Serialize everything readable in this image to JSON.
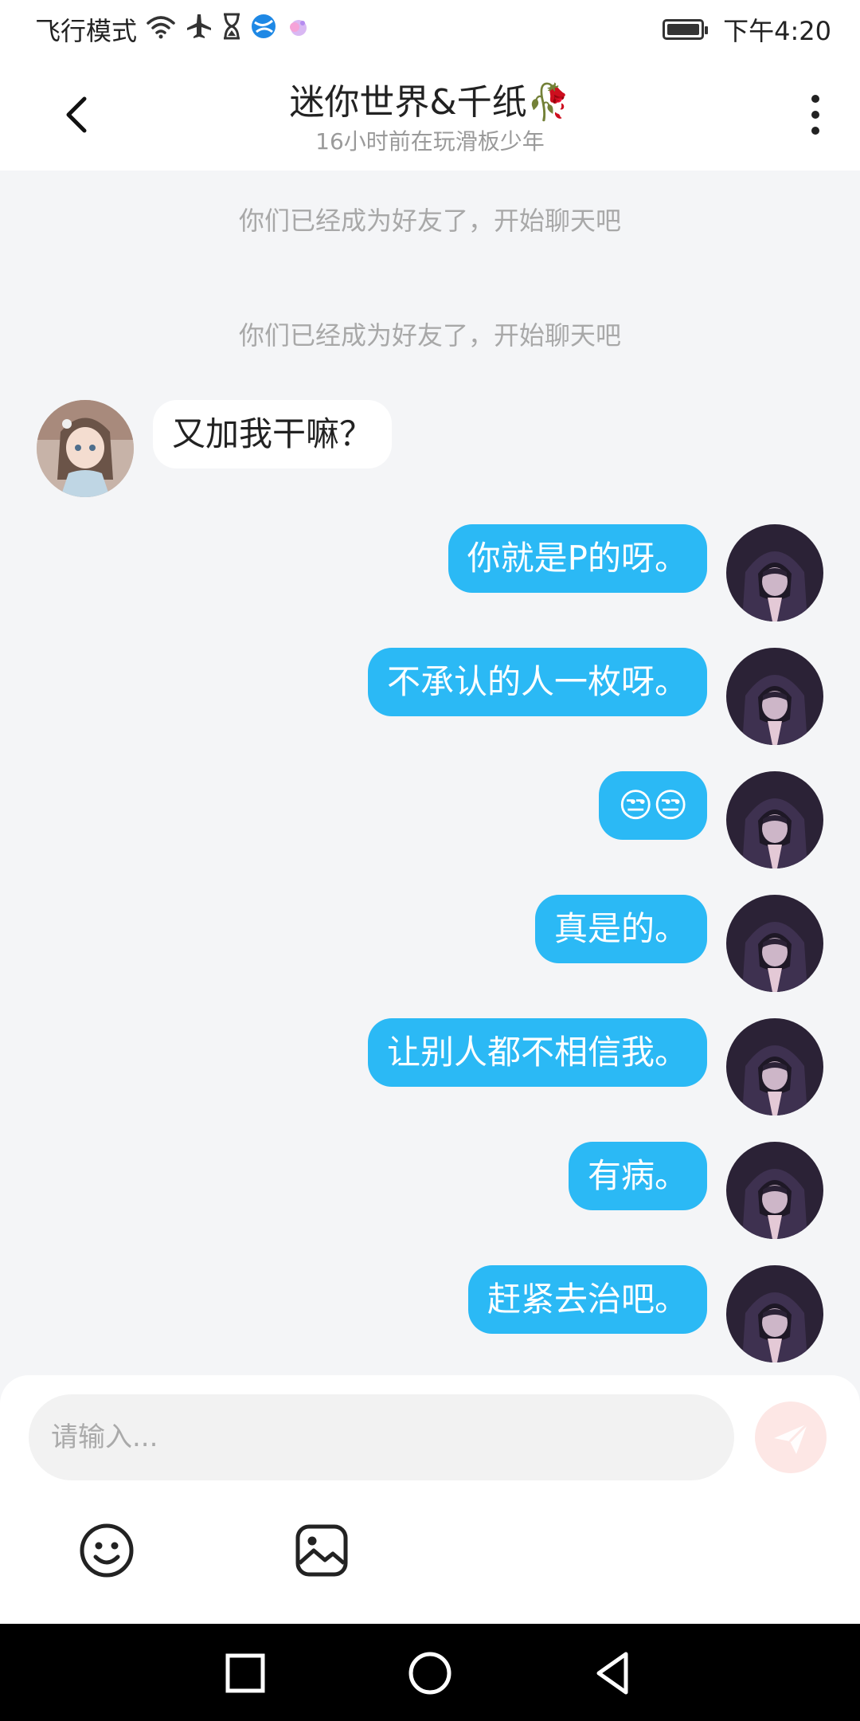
{
  "status_bar": {
    "left_text": "飞行模式",
    "icons": [
      "wifi-icon",
      "airplane-icon",
      "hourglass-icon",
      "globe-app-icon",
      "cloud-app-icon"
    ],
    "time": "下午4:20",
    "battery": "battery-icon"
  },
  "header": {
    "title": "迷你世界&千纸🥀",
    "subtitle": "16小时前在玩滑板少年",
    "back_icon": "back-chevron-icon",
    "more_icon": "more-vertical-icon"
  },
  "system_messages": [
    "你们已经成为好友了，开始聊天吧",
    "你们已经成为好友了，开始聊天吧"
  ],
  "messages": [
    {
      "side": "in",
      "text": "又加我干嘛？"
    },
    {
      "side": "out",
      "text": "你就是P的呀。"
    },
    {
      "side": "out",
      "text": "不承认的人一枚呀。"
    },
    {
      "side": "out",
      "text": "😒😒"
    },
    {
      "side": "out",
      "text": "真是的。"
    },
    {
      "side": "out",
      "text": "让别人都不相信我。"
    },
    {
      "side": "out",
      "text": "有病。"
    },
    {
      "side": "out",
      "text": "赶紧去治吧。"
    }
  ],
  "input": {
    "placeholder": "请输入..."
  },
  "toolbar": {
    "emoji_icon": "emoji-icon",
    "image_icon": "image-icon",
    "send_icon": "send-icon"
  },
  "colors": {
    "outgoing_bubble": "#2BB9F5",
    "incoming_bubble": "#FFFFFF",
    "chat_background": "#F4F5F7",
    "send_button": "#FDE7E5"
  }
}
